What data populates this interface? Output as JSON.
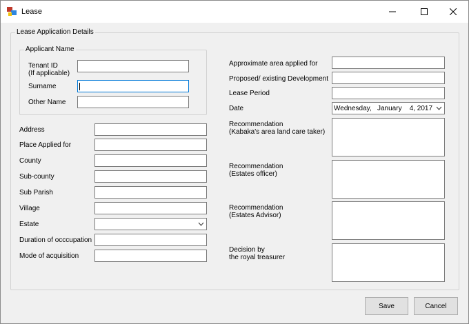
{
  "window": {
    "title": "Lease"
  },
  "details_group": {
    "legend": "Lease Application Details"
  },
  "applicant_group": {
    "legend": "Applicant Name",
    "tenant_id_label_line1": "Tenant ID",
    "tenant_id_label_line2": "(If applicable)",
    "surname_label": "Surname",
    "other_name_label": "Other Name"
  },
  "left_fields": {
    "address": "Address",
    "place_applied_for": "Place Applied for",
    "county": "County",
    "sub_county": "Sub-county",
    "sub_parish": "Sub Parish",
    "village": "Village",
    "estate": "Estate",
    "duration": "Duration of occcupation",
    "mode": "Mode of acquisition"
  },
  "right_fields": {
    "approx_area": "Approximate area applied for",
    "development": "Proposed/ existing Development",
    "lease_period": "Lease Period",
    "date_label": "Date",
    "date_value": "Wednesday,   January    4, 2017",
    "rec_kabaka_line1": "Recommendation",
    "rec_kabaka_line2": "(Kabaka's area land care taker)",
    "rec_estates_officer_line1": "Recommendation",
    "rec_estates_officer_line2": "(Estates officer)",
    "rec_estates_advisor_line1": "Recommendation",
    "rec_estates_advisor_line2": "(Estates Advisor)",
    "decision_line1": "Decision by",
    "decision_line2": "the royal treasurer"
  },
  "buttons": {
    "save": "Save",
    "cancel": "Cancel"
  },
  "icons": {
    "app": "app-window-icon",
    "minimize": "minimize-icon",
    "maximize": "maximize-icon",
    "close": "close-icon",
    "dropdown": "chevron-down-icon"
  }
}
